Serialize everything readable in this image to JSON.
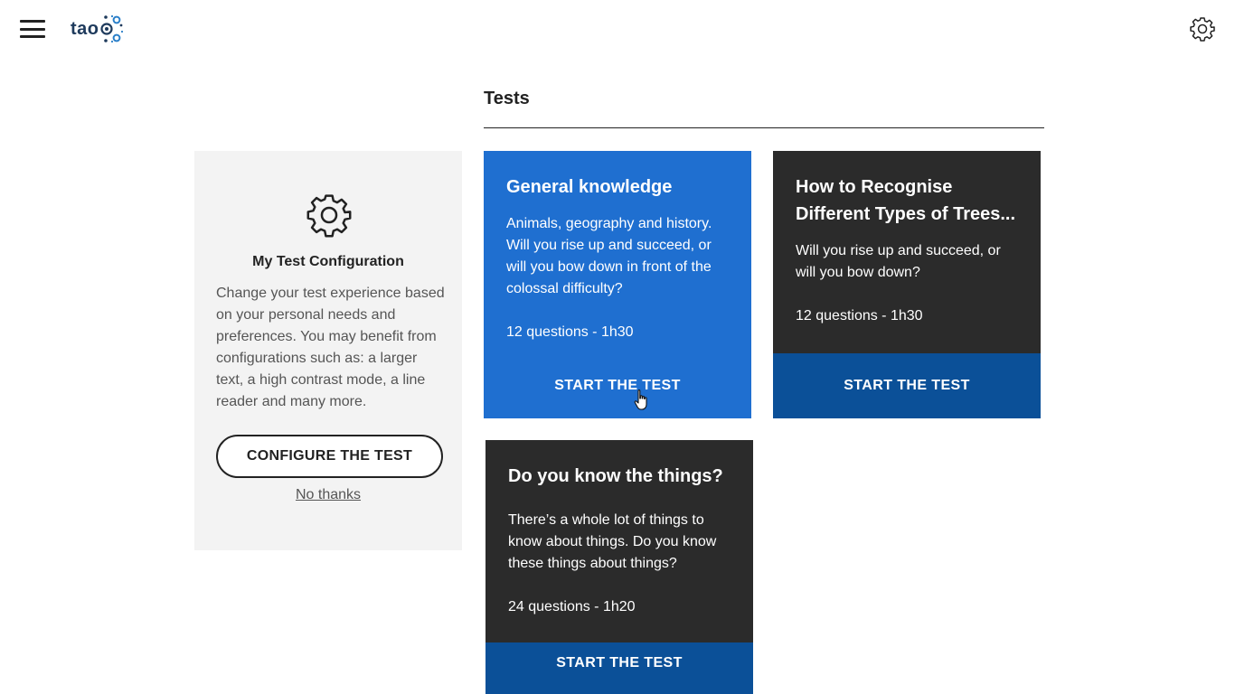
{
  "header": {
    "menu_icon": "hamburger-menu-icon",
    "logo_text": "tao",
    "settings_icon": "gear-icon"
  },
  "section": {
    "title": "Tests"
  },
  "config_card": {
    "icon": "gear-icon",
    "title": "My Test Configuration",
    "description": "Change your test experience based on your personal needs and preferences. You may benefit from configurations such as: a larger text, a high contrast mode, a line reader and many more.",
    "configure_label": "CONFIGURE THE TEST",
    "no_thanks_label": "No thanks"
  },
  "tests": [
    {
      "title": "General knowledge",
      "description": "Animals, geography and history. Will you rise up and succeed, or will you bow down in front of the colossal difficulty?",
      "meta": "12 questions - 1h30",
      "button_label": "START THE TEST"
    },
    {
      "title": "How to Recognise Different Types of Trees...",
      "description": "Will you rise up and succeed, or will you bow down?",
      "meta": "12 questions - 1h30",
      "button_label": "START THE TEST"
    },
    {
      "title": "Do you know the things?",
      "description": "There’s a whole lot of things to know about things. Do you know these things about things?",
      "meta": "24 questions - 1h20",
      "button_label": "START THE TEST"
    }
  ],
  "colors": {
    "active_card": "#1f6fd0",
    "dark_card": "#2b2b2b",
    "button_blue": "#0b5098",
    "config_bg": "#f3f3f3"
  }
}
